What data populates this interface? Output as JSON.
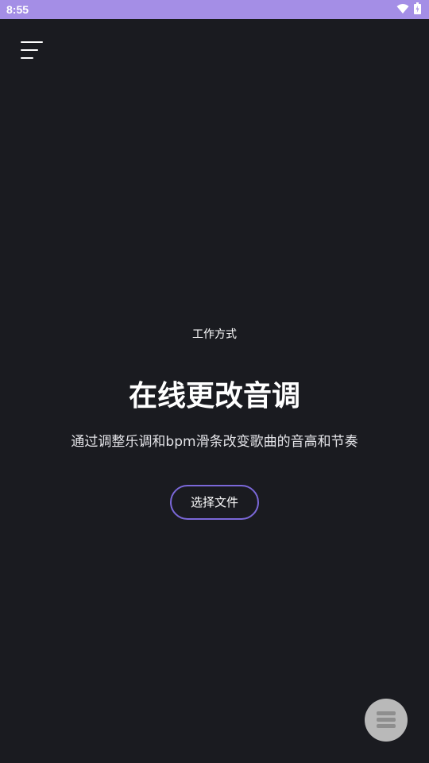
{
  "status_bar": {
    "time": "8:55",
    "background_color": "#a48ee6",
    "icons": [
      "wifi-icon",
      "battery-icon"
    ]
  },
  "header": {
    "menu_icon": "hamburger-menu-icon"
  },
  "main": {
    "subtitle": "工作方式",
    "title": "在线更改音调",
    "description": "通过调整乐调和bpm滑条改变歌曲的音高和节奏",
    "select_file_label": "选择文件",
    "button_border_color": "#7b68d9"
  },
  "fab": {
    "icon": "list-icon"
  },
  "colors": {
    "background": "#1a1b20",
    "text": "#ffffff"
  }
}
